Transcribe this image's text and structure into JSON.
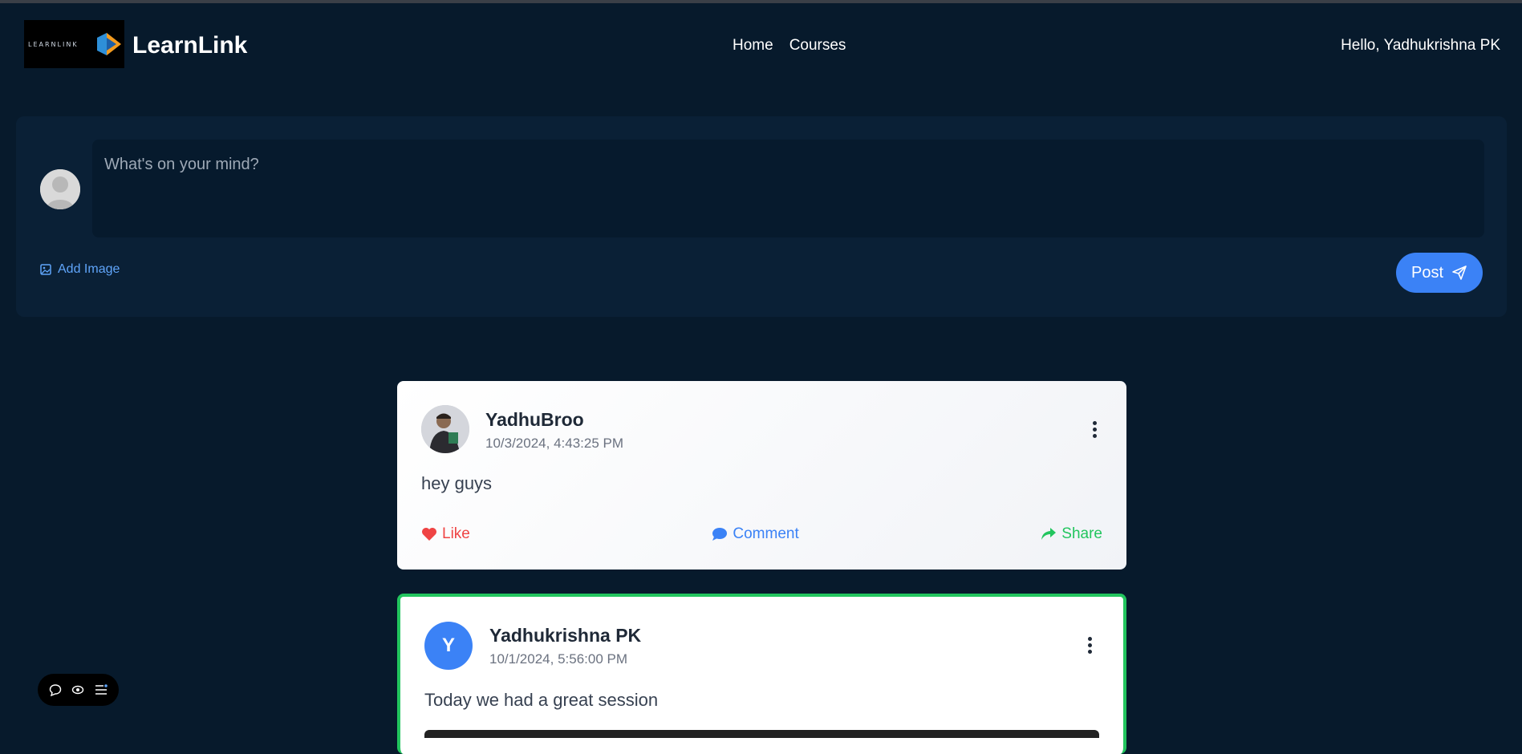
{
  "app": {
    "brand": "LearnLink",
    "logo_text": "LEARNLINK"
  },
  "nav": {
    "items": [
      {
        "label": "Home"
      },
      {
        "label": "Courses"
      }
    ]
  },
  "user": {
    "greeting": "Hello, Yadhukrishna PK"
  },
  "composer": {
    "placeholder": "What's on your mind?",
    "add_image_label": "Add Image",
    "post_label": "Post"
  },
  "posts": [
    {
      "author": "YadhuBroo",
      "timestamp": "10/3/2024, 4:43:25 PM",
      "text": "hey guys",
      "like_label": "Like",
      "comment_label": "Comment",
      "share_label": "Share"
    },
    {
      "author": "Yadhukrishna PK",
      "avatar_initial": "Y",
      "timestamp": "10/1/2024, 5:56:00 PM",
      "text": "Today we had a great session"
    }
  ],
  "colors": {
    "background": "#071a2c",
    "accent": "#3b82f6",
    "like": "#ef4444",
    "share": "#22c55e",
    "highlight_border": "#22c55e"
  },
  "icons": {
    "add_image": "image-icon",
    "post": "send-icon",
    "like": "heart-icon",
    "comment": "comment-icon",
    "share": "share-icon",
    "more": "more-vertical-icon",
    "float_bar": [
      "chat-icon",
      "eye-icon",
      "menu-icon"
    ]
  }
}
